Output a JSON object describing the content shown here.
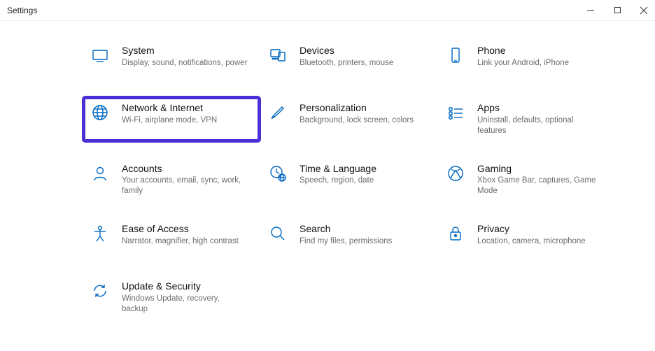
{
  "window": {
    "title": "Settings"
  },
  "tiles": [
    {
      "name": "System",
      "desc": "Display, sound, notifications, power"
    },
    {
      "name": "Devices",
      "desc": "Bluetooth, printers, mouse"
    },
    {
      "name": "Phone",
      "desc": "Link your Android, iPhone"
    },
    {
      "name": "Network & Internet",
      "desc": "Wi-Fi, airplane mode, VPN"
    },
    {
      "name": "Personalization",
      "desc": "Background, lock screen, colors"
    },
    {
      "name": "Apps",
      "desc": "Uninstall, defaults, optional features"
    },
    {
      "name": "Accounts",
      "desc": "Your accounts, email, sync, work, family"
    },
    {
      "name": "Time & Language",
      "desc": "Speech, region, date"
    },
    {
      "name": "Gaming",
      "desc": "Xbox Game Bar, captures, Game Mode"
    },
    {
      "name": "Ease of Access",
      "desc": "Narrator, magnifier, high contrast"
    },
    {
      "name": "Search",
      "desc": "Find my files, permissions"
    },
    {
      "name": "Privacy",
      "desc": "Location, camera, microphone"
    },
    {
      "name": "Update & Security",
      "desc": "Windows Update, recovery, backup"
    }
  ],
  "highlighted_index": 3
}
